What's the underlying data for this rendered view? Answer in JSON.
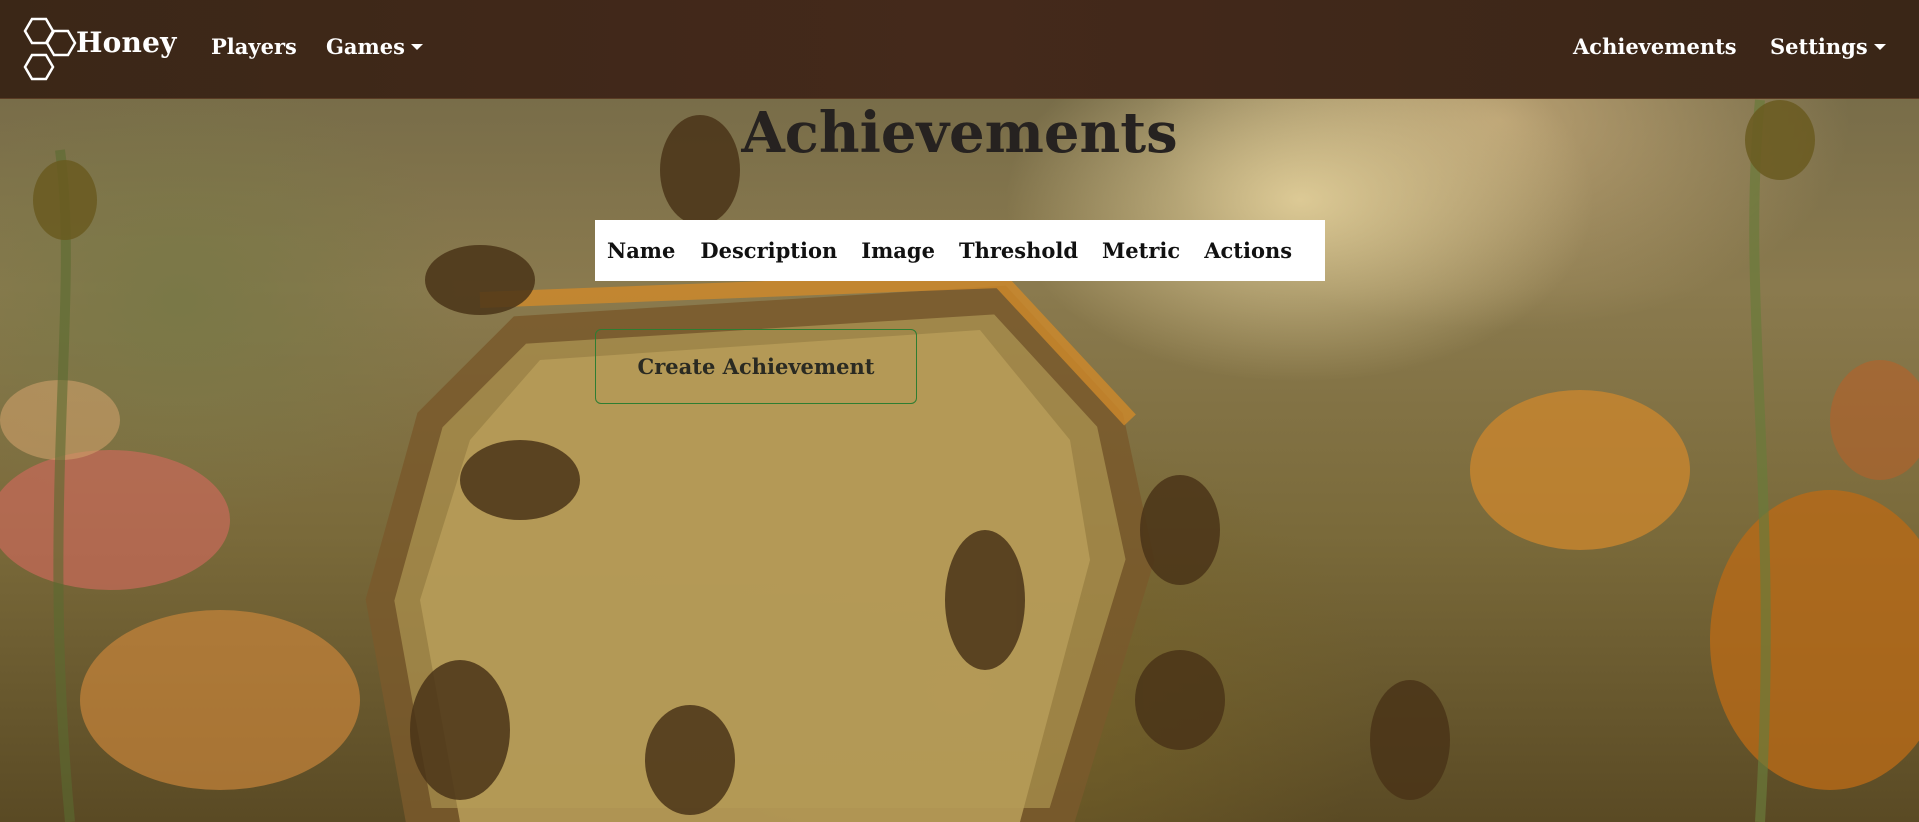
{
  "brand": {
    "name": "Honey",
    "logo_icon": "honeycomb-logo-icon"
  },
  "nav": {
    "left": [
      {
        "label": "Players",
        "dropdown": false
      },
      {
        "label": "Games",
        "dropdown": true
      }
    ],
    "right": [
      {
        "label": "Achievements",
        "dropdown": false
      },
      {
        "label": "Settings",
        "dropdown": true
      }
    ]
  },
  "page": {
    "title": "Achievements"
  },
  "table": {
    "headers": [
      "Name",
      "Description",
      "Image",
      "Threshold",
      "Metric",
      "Actions"
    ],
    "rows": []
  },
  "actions": {
    "create_label": "Create Achievement"
  },
  "colors": {
    "navbar": "#3f2819",
    "title_text": "#262220",
    "button_border": "#2e7d32"
  }
}
